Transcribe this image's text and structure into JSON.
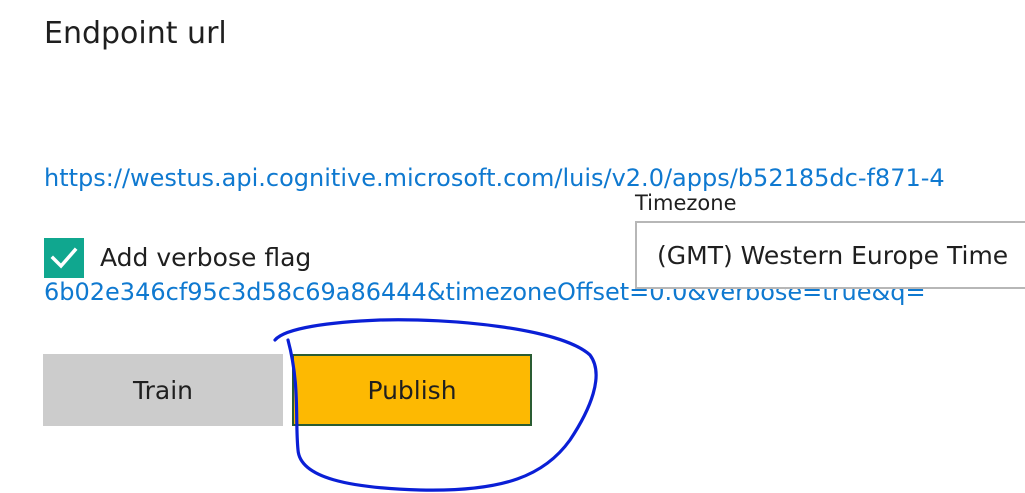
{
  "endpoint": {
    "title": "Endpoint url",
    "url_line1": "https://westus.api.cognitive.microsoft.com/luis/v2.0/apps/b52185dc-f871-4",
    "url_line2": "6b02e346cf95c3d58c69a86444&timezoneOffset=0.0&verbose=true&q="
  },
  "options": {
    "verbose_label": "Add verbose flag",
    "verbose_checked": true,
    "timezone_label": "Timezone",
    "timezone_value": "(GMT) Western Europe Time"
  },
  "actions": {
    "train_label": "Train",
    "publish_label": "Publish"
  },
  "colors": {
    "link": "#0f79d0",
    "checkbox": "#10a78f",
    "train_button": "#cccccc",
    "publish_button": "#fdb902",
    "annotation": "#0a1fd6"
  },
  "icons": {
    "checkbox": "check-icon"
  }
}
